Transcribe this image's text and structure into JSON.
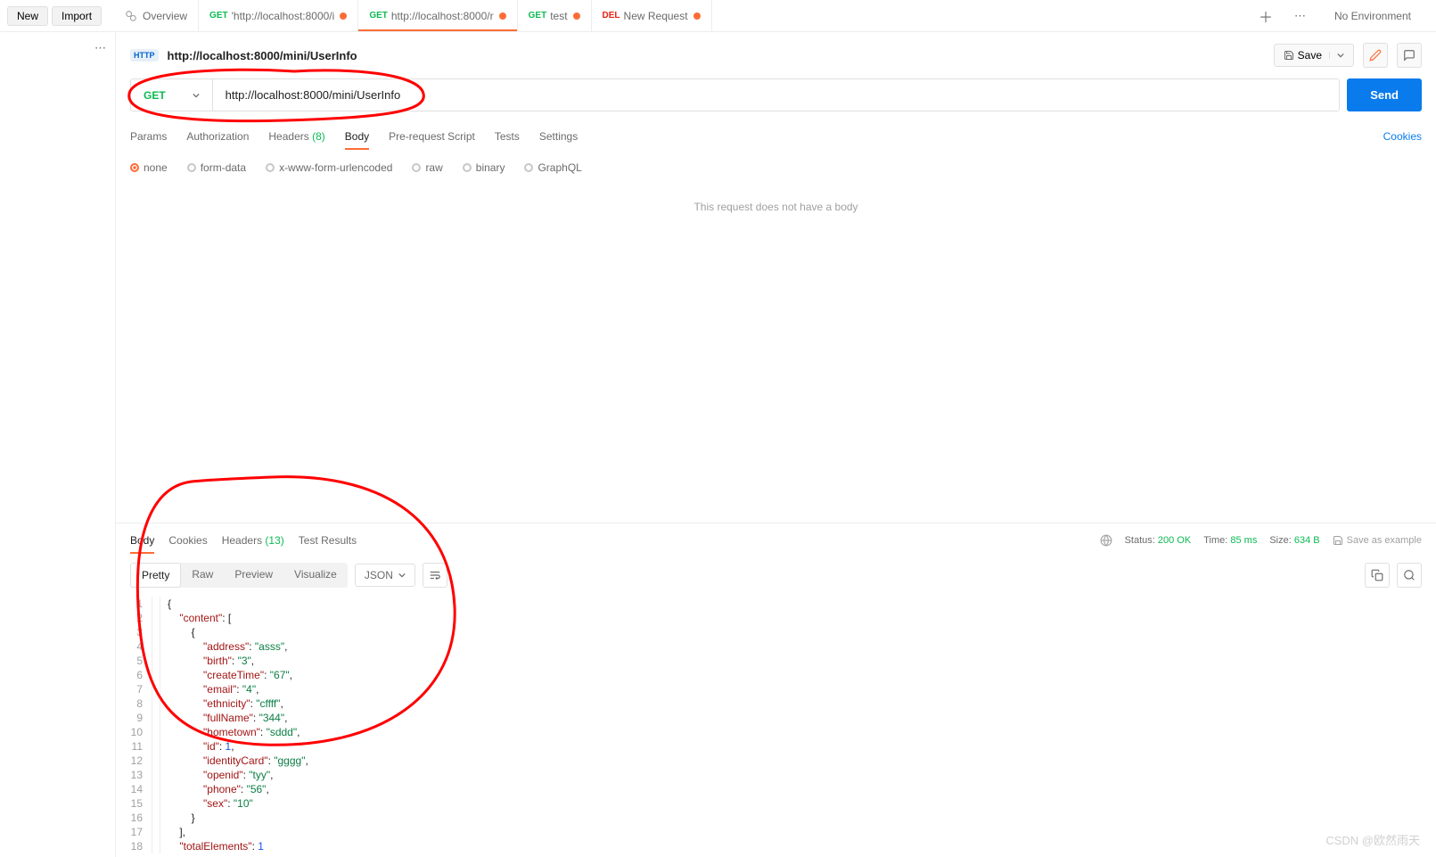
{
  "topbar": {
    "new_label": "New",
    "import_label": "Import"
  },
  "tabs": [
    {
      "method": "",
      "label": "Overview",
      "dirty": false,
      "overview": true
    },
    {
      "method": "GET",
      "label": "'http://localhost:8000/i",
      "dirty": true
    },
    {
      "method": "GET",
      "label": "http://localhost:8000/r",
      "dirty": true,
      "active": true
    },
    {
      "method": "GET",
      "label": "test",
      "dirty": true
    },
    {
      "method": "DEL",
      "label": "New Request",
      "dirty": true
    }
  ],
  "env": {
    "label": "No Environment"
  },
  "request": {
    "http_badge": "HTTP",
    "title": "http://localhost:8000/mini/UserInfo",
    "save_label": "Save",
    "method": "GET",
    "url": "http://localhost:8000/mini/UserInfo",
    "send_label": "Send"
  },
  "req_tabs": {
    "params": "Params",
    "authorization": "Authorization",
    "headers": "Headers",
    "headers_count": "(8)",
    "body": "Body",
    "prerequest": "Pre-request Script",
    "tests": "Tests",
    "settings": "Settings",
    "cookies": "Cookies"
  },
  "body_types": {
    "none": "none",
    "formdata": "form-data",
    "xwww": "x-www-form-urlencoded",
    "raw": "raw",
    "binary": "binary",
    "graphql": "GraphQL"
  },
  "body_empty": "This request does not have a body",
  "resp_tabs": {
    "body": "Body",
    "cookies": "Cookies",
    "headers": "Headers",
    "headers_count": "(13)",
    "testresults": "Test Results"
  },
  "resp_status": {
    "status_label": "Status:",
    "status_val": "200 OK",
    "time_label": "Time:",
    "time_val": "85 ms",
    "size_label": "Size:",
    "size_val": "634 B",
    "save_example": "Save as example"
  },
  "view_tabs": {
    "pretty": "Pretty",
    "raw": "Raw",
    "preview": "Preview",
    "visualize": "Visualize"
  },
  "format_select": "JSON",
  "json_lines": [
    {
      "n": 1,
      "indent": 0,
      "tokens": [
        [
          "p",
          "{"
        ]
      ]
    },
    {
      "n": 2,
      "indent": 1,
      "tokens": [
        [
          "k",
          "\"content\""
        ],
        [
          "p",
          ": ["
        ]
      ]
    },
    {
      "n": 3,
      "indent": 2,
      "tokens": [
        [
          "p",
          "{"
        ]
      ]
    },
    {
      "n": 4,
      "indent": 3,
      "tokens": [
        [
          "k",
          "\"address\""
        ],
        [
          "p",
          ": "
        ],
        [
          "s",
          "\"asss\""
        ],
        [
          "p",
          ","
        ]
      ]
    },
    {
      "n": 5,
      "indent": 3,
      "tokens": [
        [
          "k",
          "\"birth\""
        ],
        [
          "p",
          ": "
        ],
        [
          "s",
          "\"3\""
        ],
        [
          "p",
          ","
        ]
      ]
    },
    {
      "n": 6,
      "indent": 3,
      "tokens": [
        [
          "k",
          "\"createTime\""
        ],
        [
          "p",
          ": "
        ],
        [
          "s",
          "\"67\""
        ],
        [
          "p",
          ","
        ]
      ]
    },
    {
      "n": 7,
      "indent": 3,
      "tokens": [
        [
          "k",
          "\"email\""
        ],
        [
          "p",
          ": "
        ],
        [
          "s",
          "\"4\""
        ],
        [
          "p",
          ","
        ]
      ]
    },
    {
      "n": 8,
      "indent": 3,
      "tokens": [
        [
          "k",
          "\"ethnicity\""
        ],
        [
          "p",
          ": "
        ],
        [
          "s",
          "\"cffff\""
        ],
        [
          "p",
          ","
        ]
      ]
    },
    {
      "n": 9,
      "indent": 3,
      "tokens": [
        [
          "k",
          "\"fullName\""
        ],
        [
          "p",
          ": "
        ],
        [
          "s",
          "\"344\""
        ],
        [
          "p",
          ","
        ]
      ]
    },
    {
      "n": 10,
      "indent": 3,
      "tokens": [
        [
          "k",
          "\"hometown\""
        ],
        [
          "p",
          ": "
        ],
        [
          "s",
          "\"sddd\""
        ],
        [
          "p",
          ","
        ]
      ]
    },
    {
      "n": 11,
      "indent": 3,
      "tokens": [
        [
          "k",
          "\"id\""
        ],
        [
          "p",
          ": "
        ],
        [
          "n",
          "1"
        ],
        [
          "p",
          ","
        ]
      ]
    },
    {
      "n": 12,
      "indent": 3,
      "tokens": [
        [
          "k",
          "\"identityCard\""
        ],
        [
          "p",
          ": "
        ],
        [
          "s",
          "\"gggg\""
        ],
        [
          "p",
          ","
        ]
      ]
    },
    {
      "n": 13,
      "indent": 3,
      "tokens": [
        [
          "k",
          "\"openid\""
        ],
        [
          "p",
          ": "
        ],
        [
          "s",
          "\"tyy\""
        ],
        [
          "p",
          ","
        ]
      ]
    },
    {
      "n": 14,
      "indent": 3,
      "tokens": [
        [
          "k",
          "\"phone\""
        ],
        [
          "p",
          ": "
        ],
        [
          "s",
          "\"56\""
        ],
        [
          "p",
          ","
        ]
      ]
    },
    {
      "n": 15,
      "indent": 3,
      "tokens": [
        [
          "k",
          "\"sex\""
        ],
        [
          "p",
          ": "
        ],
        [
          "s",
          "\"10\""
        ]
      ]
    },
    {
      "n": 16,
      "indent": 2,
      "tokens": [
        [
          "p",
          "}"
        ]
      ]
    },
    {
      "n": 17,
      "indent": 1,
      "tokens": [
        [
          "p",
          "],"
        ]
      ]
    },
    {
      "n": 18,
      "indent": 1,
      "tokens": [
        [
          "k",
          "\"totalElements\""
        ],
        [
          "p",
          ": "
        ],
        [
          "n",
          "1"
        ]
      ]
    }
  ],
  "watermark": "CSDN @欧然雨天"
}
